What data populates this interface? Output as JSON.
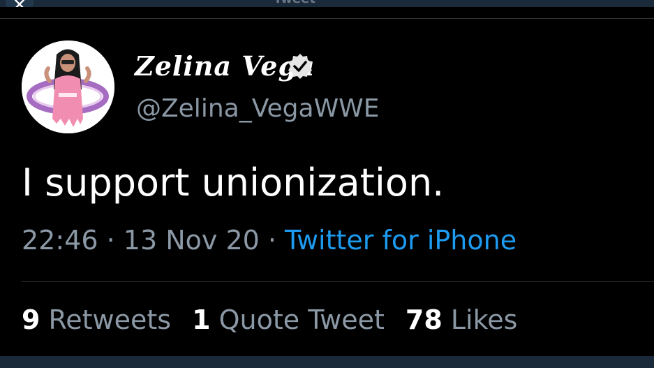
{
  "header": {
    "title": "Tweet",
    "close_icon": "close-icon"
  },
  "author": {
    "display_name": "Zelina Vega",
    "handle": "@Zelina_VegaWWE",
    "verified_icon": "verified-badge-icon"
  },
  "tweet": {
    "text": "I support unionization.",
    "time": "22:46",
    "separator": " · ",
    "date": "13 Nov 20",
    "source": "Twitter for iPhone"
  },
  "stats": {
    "retweets_count": "9",
    "retweets_label": "Retweets",
    "quotes_count": "1",
    "quotes_label": "Quote Tweet",
    "likes_count": "78",
    "likes_label": "Likes"
  },
  "colors": {
    "background": "#000000",
    "primary_text": "#ffffff",
    "secondary_text": "#8b98a5",
    "link": "#1d9bf0",
    "divider": "#2f3336"
  }
}
